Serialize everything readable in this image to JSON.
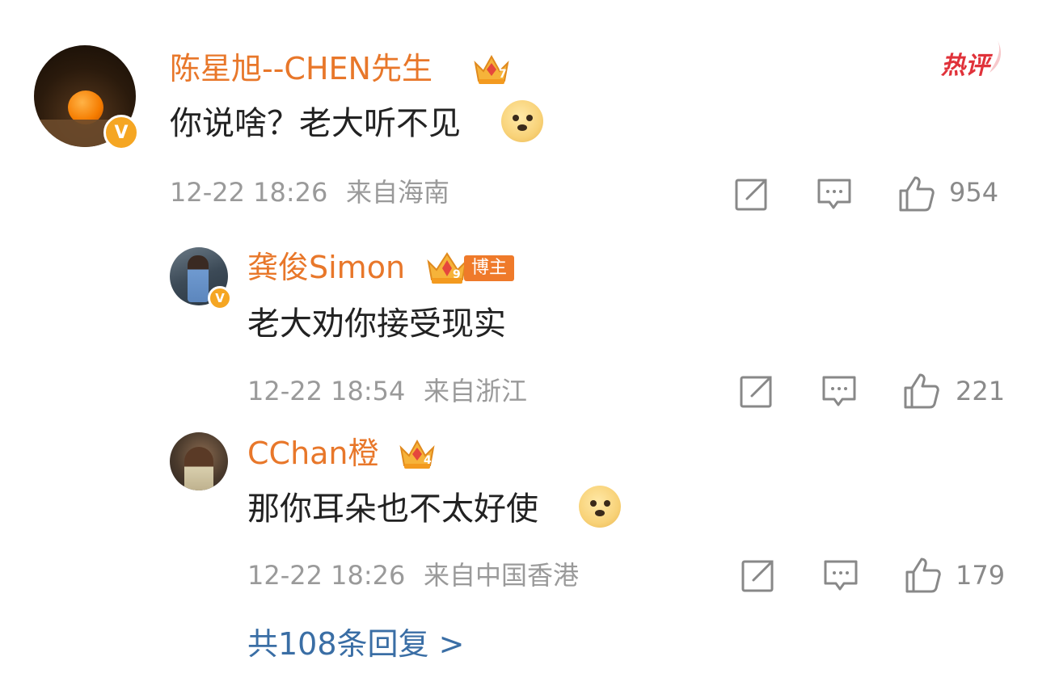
{
  "hot_badge": "热评",
  "comment": {
    "username": "陈星旭--CHEN先生",
    "crown_level": "7",
    "text": "你说啥？老大听不见",
    "time": "12-22 18:26",
    "location": "来自海南",
    "likes": "954",
    "emoji": "doge-emoji"
  },
  "replies": [
    {
      "username": "龚俊Simon",
      "crown_level": "9",
      "badge": "博主",
      "text": "老大劝你接受现实",
      "time": "12-22 18:54",
      "location": "来自浙江",
      "likes": "221"
    },
    {
      "username": "CChan橙",
      "crown_level": "4",
      "text": "那你耳朵也不太好使",
      "time": "12-22 18:26",
      "location": "来自中国香港",
      "likes": "179",
      "emoji": "doge-emoji"
    }
  ],
  "more_replies": "共108条回复 >",
  "colors": {
    "username": "#e8772a",
    "link": "#3a6ea5",
    "meta": "#9a9a9a",
    "hot": "#e0323a"
  },
  "icons": [
    "share-icon",
    "comment-icon",
    "like-icon",
    "crown-icon",
    "verified-v-icon",
    "doge-emoji"
  ]
}
